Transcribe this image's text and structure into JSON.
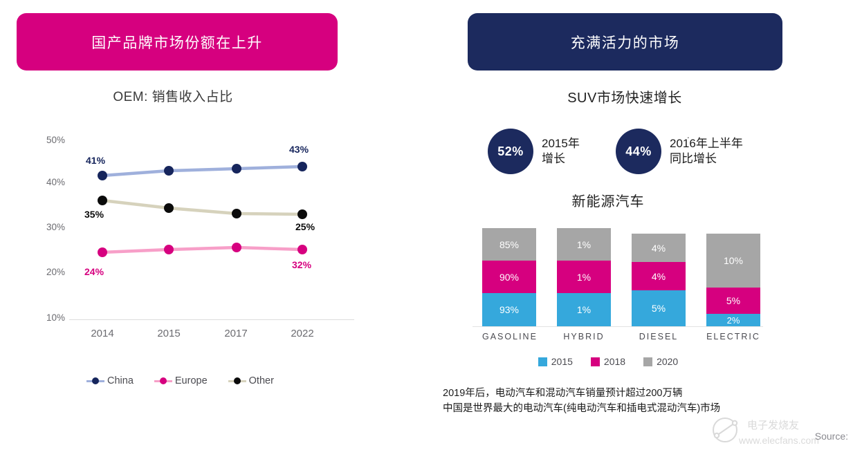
{
  "left": {
    "header_title": "国产品牌市场份额在上升",
    "header_color": "#D6007F",
    "chart_title": "OEM: 销售收入占比"
  },
  "right": {
    "header_title": "充满活力的市场",
    "header_color": "#1C2A5E",
    "suv_title": "SUV市场快速增长",
    "nev_title": "新能源汽车",
    "stats": [
      {
        "value": "52%",
        "label": "2015年\n增长",
        "label_line1": "2015年",
        "label_line2": "增长"
      },
      {
        "value": "44%",
        "label": "2016年上半年\n同比增长",
        "label_line1": "2016年上半年",
        "label_line2": "同比增长"
      }
    ],
    "dot_mark": ".",
    "footnote_line1": "2019年后，电动汽车和混动汽车销量预计超过200万辆",
    "footnote_line2": "中国是世界最大的电动汽车(纯电动汽车和插电式混动汽车)市场",
    "source_label": "Source:",
    "watermark_text": "电子发烧友"
  },
  "chart_data": [
    {
      "type": "line",
      "title": "OEM: 销售收入占比",
      "xlabel": "",
      "ylabel": "",
      "ylim": [
        10,
        50
      ],
      "grid": false,
      "legend_position": "bottom",
      "categories": [
        "2014",
        "2015",
        "2017",
        "2022"
      ],
      "ytick_labels": [
        "50%",
        "40%",
        "30%",
        "20%",
        "10%"
      ],
      "ytick_values": [
        50,
        40,
        30,
        20,
        10
      ],
      "series": [
        {
          "name": "China",
          "line_color": "#9FB0DC",
          "marker_color": "#16255C",
          "values": [
            41,
            42,
            42.3,
            43
          ],
          "annotations": [
            {
              "text": "41%",
              "at": "2014",
              "color": "#16255C"
            },
            {
              "text": "43%",
              "at": "2022",
              "color": "#16255C"
            }
          ]
        },
        {
          "name": "Europe",
          "line_color": "#F79FC8",
          "marker_color": "#D6007F",
          "values": [
            24.1,
            24.6,
            25.0,
            24.6
          ],
          "annotations": [
            {
              "text": "24%",
              "at": "2014",
              "color": "#D6007F"
            },
            {
              "text": "32%",
              "at": "2022",
              "color": "#D6007F"
            }
          ]
        },
        {
          "name": "Other",
          "line_color": "#D6D2BC",
          "marker_color": "#0B0B0B",
          "values": [
            35,
            33.4,
            32.4,
            32.3
          ],
          "annotations": [
            {
              "text": "35%",
              "at": "2014",
              "color": "#0B0B0B"
            },
            {
              "text": "25%",
              "at": "2022",
              "color": "#0B0B0B"
            }
          ]
        }
      ]
    },
    {
      "type": "bar",
      "subtype": "stacked",
      "title": "新能源汽车",
      "xlabel": "",
      "ylabel": "",
      "grid": false,
      "legend_position": "bottom",
      "categories": [
        "GASOLINE",
        "HYBRID",
        "DIESEL",
        "ELECTRIC"
      ],
      "series": [
        {
          "name": "2015",
          "color": "#35A8DC",
          "values": [
            93,
            1,
            5,
            2
          ],
          "labels": [
            "93%",
            "1%",
            "5%",
            "2%"
          ]
        },
        {
          "name": "2018",
          "color": "#D6007F",
          "values": [
            90,
            1,
            4,
            5
          ],
          "labels": [
            "90%",
            "1%",
            "4%",
            "5%"
          ]
        },
        {
          "name": "2020",
          "color": "#A6A6A6",
          "values": [
            85,
            1,
            4,
            10
          ],
          "labels": [
            "85%",
            "1%",
            "4%",
            "10%"
          ]
        }
      ]
    }
  ]
}
